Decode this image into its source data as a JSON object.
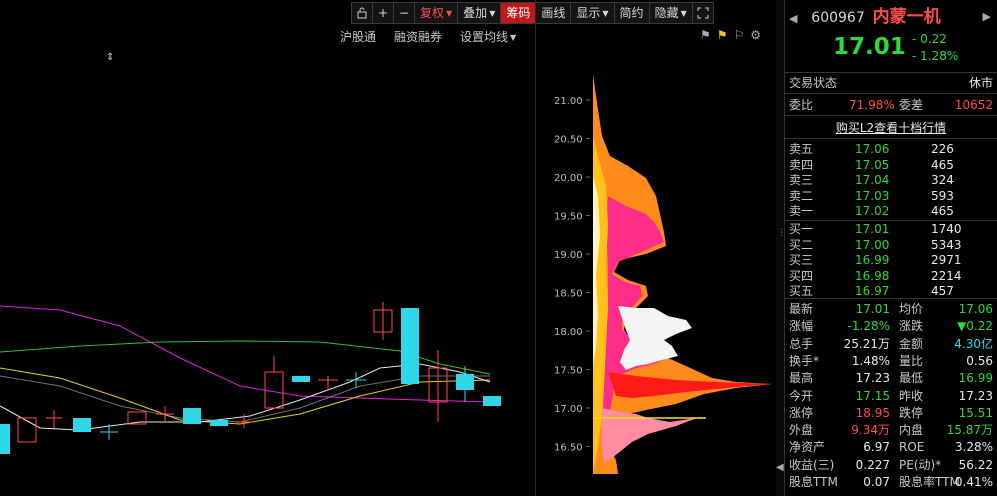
{
  "toolbar": {
    "buttons": [
      {
        "label": "",
        "icon": "lock-icon"
      },
      {
        "label": "+",
        "icon": "plus-icon"
      },
      {
        "label": "−",
        "icon": "minus-icon"
      },
      {
        "label": "复权",
        "dropdown": true
      },
      {
        "label": "叠加",
        "dropdown": true
      },
      {
        "label": "筹码"
      },
      {
        "label": "画线"
      },
      {
        "label": "显示",
        "dropdown": true
      },
      {
        "label": "简约"
      },
      {
        "label": "隐藏",
        "dropdown": true
      },
      {
        "label": "",
        "icon": "fullscreen-icon"
      }
    ]
  },
  "subbar": {
    "hsgt": "沪股通",
    "margin": "融资融券",
    "ma_setting": "设置均线"
  },
  "chip": {
    "price_ticks": [
      "21.00",
      "20.50",
      "20.00",
      "19.50",
      "19.00",
      "18.50",
      "18.00",
      "17.50",
      "17.00",
      "16.50"
    ]
  },
  "colors": {
    "up": "#ff4d4d",
    "down": "#2fd8e8",
    "chip_orange": "#ff8c1a",
    "chip_pink": "#ff2d8a",
    "chip_yellow": "#ffc21a",
    "chip_red": "#ff1a1a"
  },
  "quote": {
    "code": "600967",
    "name": "内蒙一机",
    "price": "17.01",
    "change": "- 0.22",
    "change_pct": "- 1.28%",
    "status_label": "交易状态",
    "status_value": "休市",
    "weibi_label": "委比",
    "weibi_value": "71.98%",
    "weicha_label": "委差",
    "weicha_value": "10652",
    "l2_link": "购买L2查看十档行情",
    "sells": [
      {
        "label": "卖五",
        "price": "17.06",
        "volume": "226"
      },
      {
        "label": "卖四",
        "price": "17.05",
        "volume": "465"
      },
      {
        "label": "卖三",
        "price": "17.04",
        "volume": "324"
      },
      {
        "label": "卖二",
        "price": "17.03",
        "volume": "593"
      },
      {
        "label": "卖一",
        "price": "17.02",
        "volume": "465"
      }
    ],
    "buys": [
      {
        "label": "买一",
        "price": "17.01",
        "volume": "1740"
      },
      {
        "label": "买二",
        "price": "17.00",
        "volume": "5343"
      },
      {
        "label": "买三",
        "price": "16.99",
        "volume": "2971"
      },
      {
        "label": "买四",
        "price": "16.98",
        "volume": "2214"
      },
      {
        "label": "买五",
        "price": "16.97",
        "volume": "457"
      }
    ],
    "stats": [
      {
        "l1": "最新",
        "v1": "17.01",
        "c1": "green",
        "l2": "均价",
        "v2": "17.06",
        "c2": "green"
      },
      {
        "l1": "涨幅",
        "v1": "-1.28%",
        "c1": "green",
        "l2": "涨跌",
        "v2": "▼0.22",
        "c2": "green"
      },
      {
        "l1": "总手",
        "v1": "25.21万",
        "c1": "white",
        "l2": "金额",
        "v2": "4.30亿",
        "c2": "cyan"
      },
      {
        "l1": "换手*",
        "v1": "1.48%",
        "c1": "white",
        "l2": "量比",
        "v2": "0.56",
        "c2": "white"
      },
      {
        "l1": "最高",
        "v1": "17.23",
        "c1": "white",
        "l2": "最低",
        "v2": "16.99",
        "c2": "green"
      },
      {
        "l1": "今开",
        "v1": "17.15",
        "c1": "green",
        "l2": "昨收",
        "v2": "17.23",
        "c2": "white"
      },
      {
        "l1": "涨停",
        "v1": "18.95",
        "c1": "red",
        "l2": "跌停",
        "v2": "15.51",
        "c2": "green"
      },
      {
        "l1": "外盘",
        "v1": "9.34万",
        "c1": "red",
        "l2": "内盘",
        "v2": "15.87万",
        "c2": "green"
      },
      {
        "l1": "净资产",
        "v1": "6.97",
        "c1": "white",
        "l2": "ROE",
        "v2": "3.28%",
        "c2": "white"
      },
      {
        "l1": "收益(三)",
        "v1": "0.227",
        "c1": "white",
        "l2": "PE(动)*",
        "v2": "56.22",
        "c2": "white"
      },
      {
        "l1": "股息TTM",
        "v1": "0.07",
        "c1": "white",
        "l2": "股息率TTM",
        "v2": "0.41%",
        "c2": "white"
      }
    ]
  }
}
